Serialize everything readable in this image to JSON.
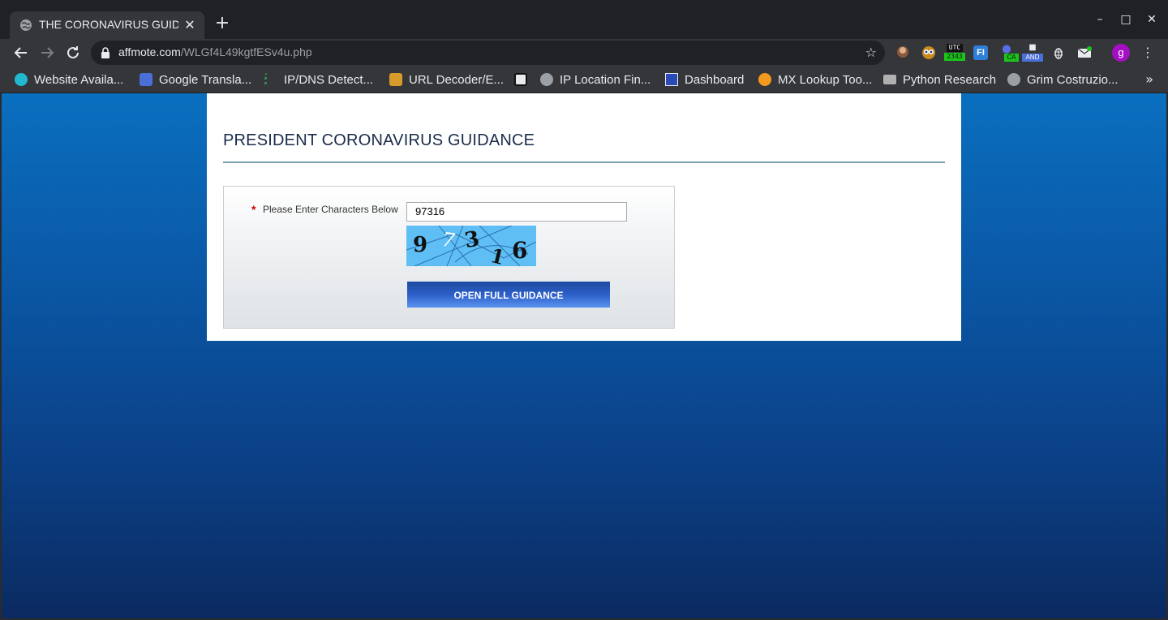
{
  "browser": {
    "tab_title": "THE CORONAVIRUS GUIDANCE",
    "tab_close": "✕",
    "new_tab": "+",
    "url_host": "affmote.com",
    "url_path": "/WLGf4L49kgtfESv4u.php",
    "profile_initial": "g",
    "ext_utc_label": "UTC",
    "ext_utc_time": "2343",
    "ext_ca_badge": "CA",
    "ext_and_badge": "AND",
    "ext_fi": "FI",
    "window_controls": {
      "minimize": "–",
      "maximize": "□",
      "close": "✕"
    }
  },
  "bookmarks": [
    {
      "label": "Website Availa...",
      "color": "#22b8cf"
    },
    {
      "label": "Google Transla...",
      "color": "#4a6fd8"
    },
    {
      "label": "IP/DNS Detect...",
      "color": "#2f8f4f"
    },
    {
      "label": "URL Decoder/E...",
      "color": "#d89a2a"
    },
    {
      "label": "",
      "color": "#e8eaed"
    },
    {
      "label": "IP Location Fin...",
      "color": "#9aa0a6"
    },
    {
      "label": "Dashboard",
      "color": "#2a4bb5"
    },
    {
      "label": "MX Lookup Too...",
      "color": "#f29a1f"
    },
    {
      "label": "Python Research",
      "color": "#b0b0b0"
    },
    {
      "label": "Grim Costruzio...",
      "color": "#9aa0a6"
    }
  ],
  "bookmarks_more": "»",
  "page": {
    "title": "PRESIDENT CORONAVIRUS GUIDANCE",
    "required_mark": "*",
    "captcha_label": "Please Enter Characters Below",
    "captcha_value": "97316",
    "captcha_chars": [
      "9",
      "7",
      "3",
      "1",
      "6"
    ],
    "submit_label": "OPEN FULL GUIDANCE"
  },
  "colors": {
    "page_bg_top": "#0a6fbf",
    "page_bg_bottom": "#0b2a60",
    "button": "#2c5fc9",
    "captcha_bg": "#5fbff5",
    "required": "#cc0000"
  }
}
